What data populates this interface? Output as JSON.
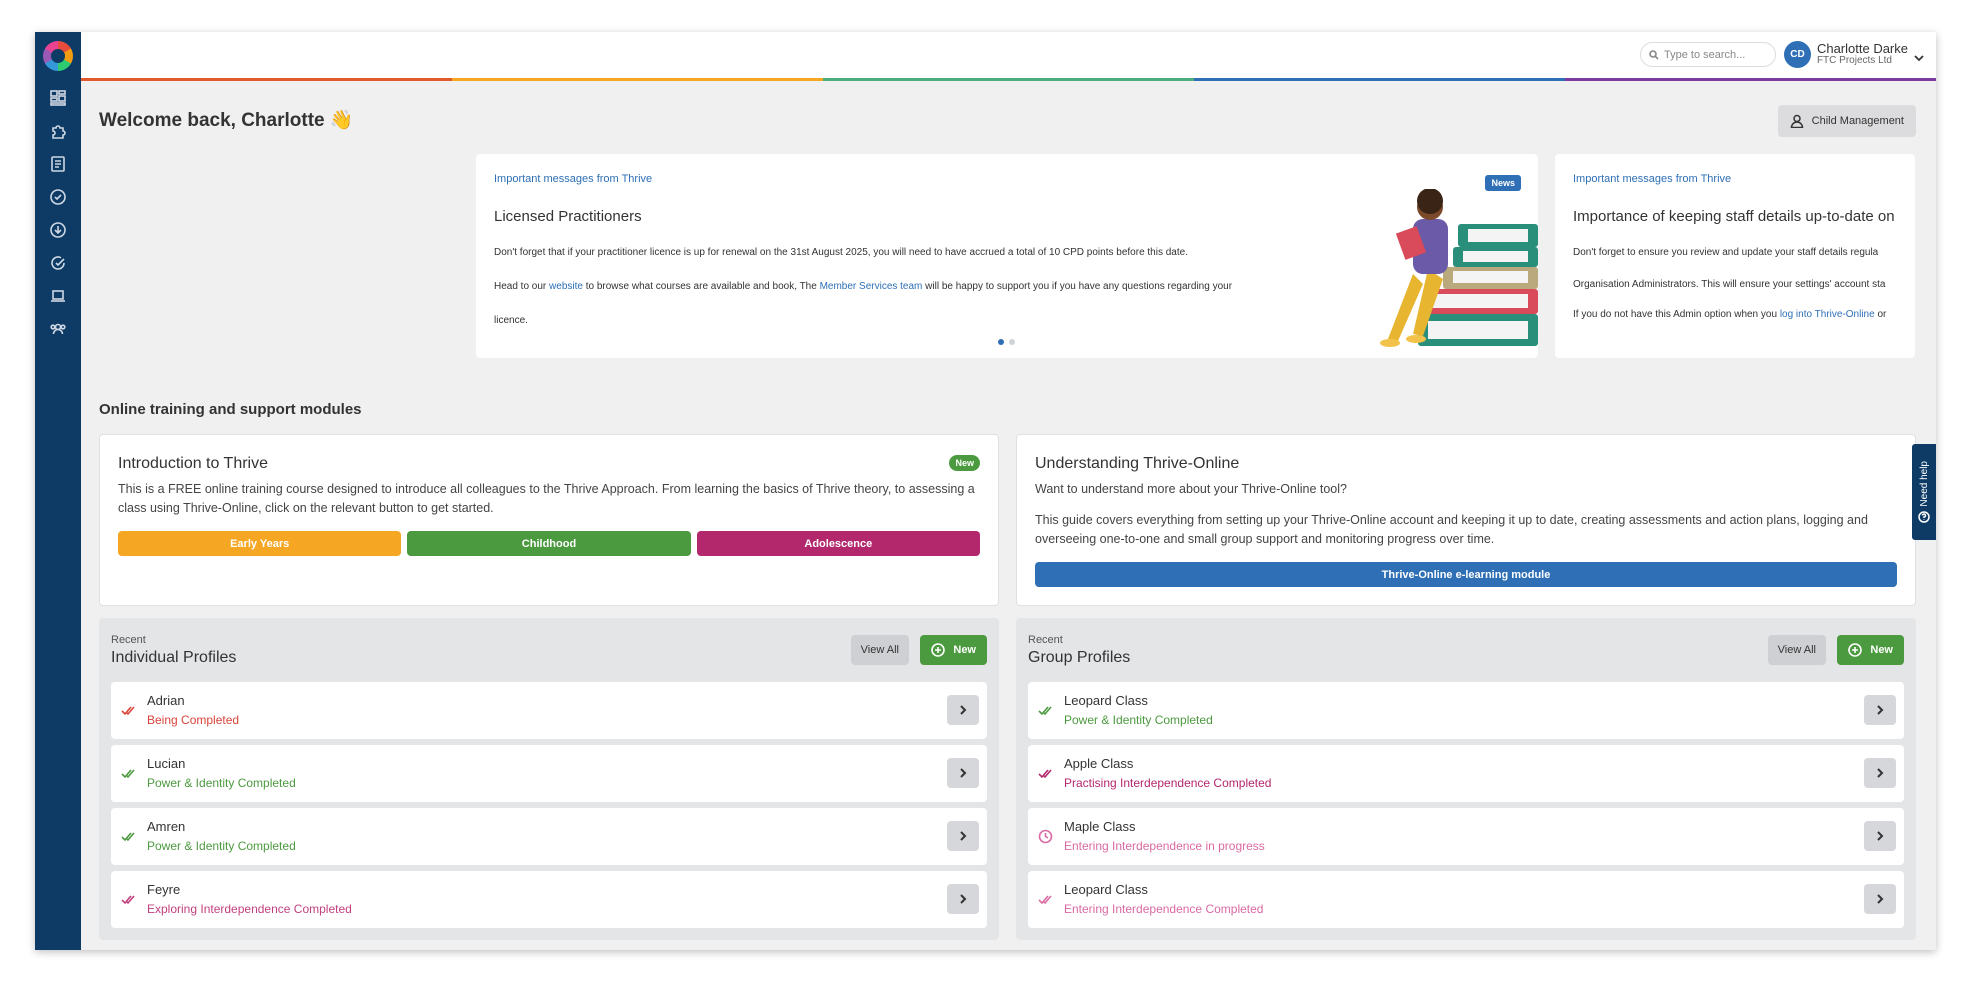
{
  "header": {
    "search_placeholder": "Type to search...",
    "user": {
      "initials": "CD",
      "name": "Charlotte Darke",
      "org": "FTC Projects Ltd"
    }
  },
  "sidebar": {
    "icons": [
      "dashboard-icon",
      "puzzle-icon",
      "document-icon",
      "check-circle-icon",
      "download-icon",
      "progress-icon",
      "laptop-icon",
      "group-icon"
    ]
  },
  "colors": {
    "accent": "#2e6fb5",
    "sidebar": "#0d3b66",
    "green": "#4c9a3f",
    "orange": "#f5a623",
    "magenta": "#b3276d",
    "rainbow": [
      "#e05a2b",
      "#f5a623",
      "#4cae7d",
      "#2e6fb5",
      "#7b3aa0"
    ]
  },
  "welcome": {
    "title": "Welcome back, Charlotte 👋",
    "child_management": "Child Management"
  },
  "messages": [
    {
      "kicker": "Important messages from Thrive",
      "title": "Licensed Practitioners",
      "badge": "News",
      "p1": "Don't forget that if your practitioner licence is up for renewal on the 31st August 2025, you will need to have accrued a total of 10 CPD points before this date.",
      "p2_a": "Head to our ",
      "p2_link1": "website",
      "p2_b": " to browse what courses are available and book, The ",
      "p2_link2": "Member Services team",
      "p2_c": " will be happy to support you if you have any questions regarding your",
      "p3": "licence."
    },
    {
      "kicker": "Important messages from Thrive",
      "title": "Importance of keeping staff details up-to-date on",
      "p1": "Don't forget to ensure you review and update your staff details regula",
      "p2": "Organisation Administrators. This will ensure your settings' account sta",
      "p3_a": "If you do not have this Admin option when you ",
      "p3_link": "log into Thrive-Online",
      "p3_b": " or"
    }
  ],
  "modules": {
    "section_title": "Online training and support modules",
    "intro": {
      "title": "Introduction to Thrive",
      "badge": "New",
      "text": "This is a FREE online training course designed to introduce all colleagues to the Thrive Approach. From learning the basics of Thrive theory, to assessing a class using Thrive-Online, click on the relevant button to get started.",
      "buttons": [
        "Early Years",
        "Childhood",
        "Adolescence"
      ]
    },
    "understanding": {
      "title": "Understanding Thrive-Online",
      "subtitle": "Want to understand more about your Thrive-Online tool?",
      "text": "This guide covers everything from setting up your Thrive-Online account and keeping it up to date, creating assessments and action plans, logging and overseeing one-to-one and small group support and monitoring progress over time.",
      "button": "Thrive-Online e-learning module"
    }
  },
  "individual": {
    "recent": "Recent",
    "title": "Individual Profiles",
    "view_all": "View All",
    "new": "New",
    "rows": [
      {
        "name": "Adrian",
        "status": "Being Completed",
        "color": "#d9443a",
        "icon": "double-check-icon"
      },
      {
        "name": "Lucian",
        "status": "Power & Identity Completed",
        "color": "#4c9a3f",
        "icon": "double-check-icon"
      },
      {
        "name": "Amren",
        "status": "Power & Identity Completed",
        "color": "#4c9a3f",
        "icon": "double-check-icon"
      },
      {
        "name": "Feyre",
        "status": "Exploring Interdependence Completed",
        "color": "#c2407e",
        "icon": "double-check-icon"
      }
    ]
  },
  "group": {
    "recent": "Recent",
    "title": "Group Profiles",
    "view_all": "View All",
    "new": "New",
    "rows": [
      {
        "name": "Leopard Class",
        "status": "Power & Identity Completed",
        "color": "#4c9a3f",
        "icon": "double-check-icon"
      },
      {
        "name": "Apple Class",
        "status": "Practising Interdependence Completed",
        "color": "#b3276d",
        "icon": "double-check-icon"
      },
      {
        "name": "Maple Class",
        "status": "Entering Interdependence in progress",
        "color": "#d96aa3",
        "icon": "clock-icon"
      },
      {
        "name": "Leopard Class",
        "status": "Entering Interdependence Completed",
        "color": "#d96aa3",
        "icon": "double-check-icon"
      }
    ]
  },
  "need_help": "Need help"
}
